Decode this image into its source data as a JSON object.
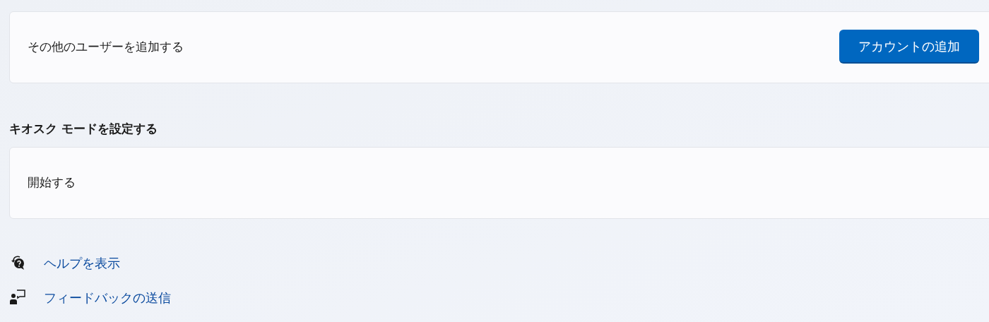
{
  "accounts_card": {
    "label": "その他のユーザーを追加する",
    "button": "アカウントの追加"
  },
  "kiosk": {
    "heading": "キオスク モードを設定する",
    "card_label": "開始する"
  },
  "links": [
    {
      "kind": "help",
      "label": "ヘルプを表示"
    },
    {
      "kind": "feedback",
      "label": "フィードバックの送信"
    }
  ]
}
